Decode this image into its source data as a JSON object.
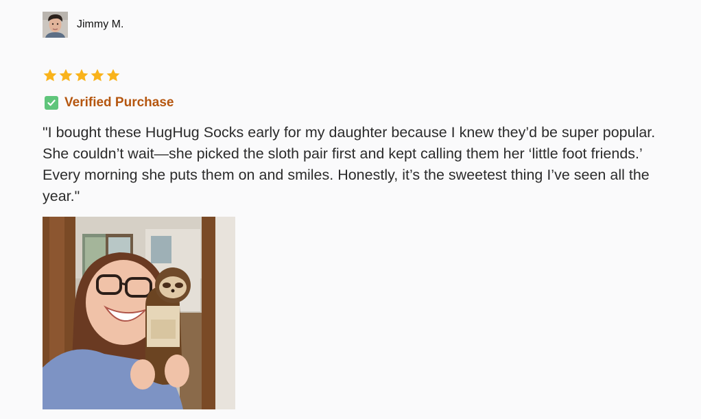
{
  "review": {
    "reviewer_name": "Jimmy M.",
    "avatar_icon": "user-avatar-photo",
    "rating": 5,
    "rating_max": 5,
    "star_color": "#f9b31b",
    "verified_label": "Verified Purchase",
    "verified_icon": "check-box-icon",
    "verified_color": "#b5560f",
    "text": "\"I bought these HugHug Socks early for my daughter because I knew they’d be super popular. She couldn’t wait—she picked the sloth pair first and kept calling them her ‘little foot friends.’ Every morning she puts them on and smiles. Honestly, it’s the sweetest thing I’ve seen all the year.\"",
    "photo_icon": "customer-photo-sloth-socks"
  }
}
